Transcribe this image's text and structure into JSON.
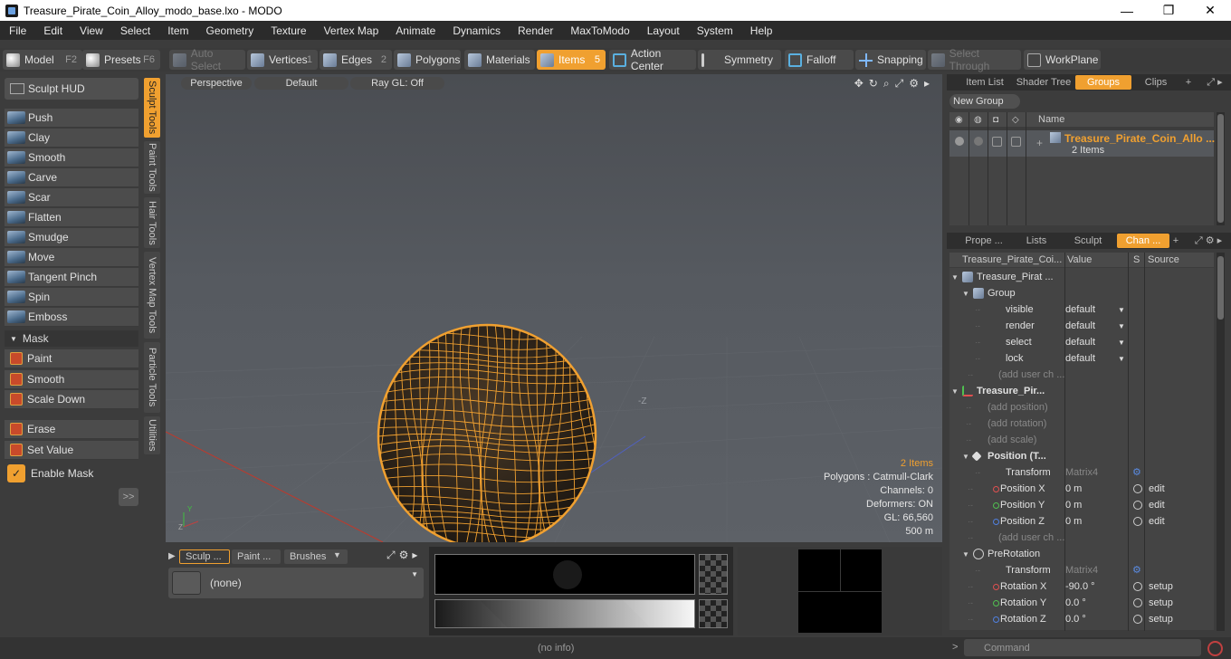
{
  "window": {
    "title": "Treasure_Pirate_Coin_Alloy_modo_base.lxo - MODO",
    "minimize": "—",
    "maximize": "❐",
    "close": "✕"
  },
  "menu": [
    "File",
    "Edit",
    "View",
    "Select",
    "Item",
    "Geometry",
    "Texture",
    "Vertex Map",
    "Animate",
    "Dynamics",
    "Render",
    "MaxToModo",
    "Layout",
    "System",
    "Help"
  ],
  "toolbar": {
    "model": "Model",
    "model_key": "F2",
    "presets": "Presets",
    "presets_key": "F6",
    "auto_select": "Auto Select",
    "vertices": "Vertices",
    "vertices_key": "1",
    "edges": "Edges",
    "edges_key": "2",
    "polygons": "Polygons",
    "materials": "Materials",
    "items": "Items",
    "items_key": "5",
    "action_center": "Action Center",
    "symmetry": "Symmetry",
    "falloff": "Falloff",
    "snapping": "Snapping",
    "select_through": "Select Through",
    "workplane": "WorkPlane",
    "accent": "#f0a030"
  },
  "sculpt": {
    "hud": "Sculpt HUD",
    "tools": [
      "Push",
      "Clay",
      "Smooth",
      "Carve",
      "Scar",
      "Flatten",
      "Smudge",
      "Move",
      "Tangent Pinch",
      "Spin",
      "Emboss"
    ],
    "mask_header": "Mask",
    "mask_tools": [
      "Paint",
      "Smooth",
      "Scale Down"
    ],
    "other_tools": [
      "Erase",
      "Set Value"
    ],
    "enable_mask": "Enable Mask",
    "expand": ">>",
    "side_tabs": [
      "Sculpt Tools",
      "Paint Tools",
      "Hair Tools",
      "Vertex Map Tools",
      "Particle Tools",
      "Utilities"
    ]
  },
  "viewport": {
    "view": "Perspective",
    "shading": "Default",
    "raygl": "Ray GL: Off",
    "axis_label": "-Z",
    "info": {
      "items": "2 Items",
      "polygons": "Polygons : Catmull-Clark",
      "channels": "Channels: 0",
      "deformers": "Deformers: ON",
      "gl": "GL: 66,560",
      "scale": "500 m"
    }
  },
  "brush_panel": {
    "tabs": [
      "Sculp ...",
      "Paint ...",
      "Brushes"
    ],
    "selected": "(none)"
  },
  "status": {
    "info": "(no info)",
    "command_placeholder": "Command"
  },
  "groups_panel": {
    "tabs": [
      "Item List",
      "Shader Tree",
      "Groups",
      "Clips"
    ],
    "new_group": "New Group",
    "col_name": "Name",
    "group_name": "Treasure_Pirate_Coin_Allo ...",
    "group_sub": "2 Items"
  },
  "channels_panel": {
    "tabs": [
      "Prope ...",
      "Lists",
      "Sculpt",
      "Chan ..."
    ],
    "col_item": "Treasure_Pirate_Coi...",
    "col_value": "Value",
    "col_s": "S",
    "col_source": "Source",
    "rows": [
      {
        "name": "Treasure_Pirat ...",
        "value": "",
        "src": ""
      },
      {
        "name": "Group",
        "value": "",
        "src": ""
      },
      {
        "name": "visible",
        "value": "default",
        "src": ""
      },
      {
        "name": "render",
        "value": "default",
        "src": ""
      },
      {
        "name": "select",
        "value": "default",
        "src": ""
      },
      {
        "name": "lock",
        "value": "default",
        "src": ""
      },
      {
        "name": "(add user ch ...",
        "value": "",
        "src": ""
      },
      {
        "name": "Treasure_Pir...",
        "value": "",
        "src": ""
      },
      {
        "name": "(add position)",
        "value": "",
        "src": ""
      },
      {
        "name": "(add rotation)",
        "value": "",
        "src": ""
      },
      {
        "name": "(add scale)",
        "value": "",
        "src": ""
      },
      {
        "name": "Position (T...",
        "value": "",
        "src": ""
      },
      {
        "name": "Transform",
        "value": "Matrix4",
        "src": ""
      },
      {
        "name": "Position X",
        "value": "0 m",
        "src": "edit"
      },
      {
        "name": "Position Y",
        "value": "0 m",
        "src": "edit"
      },
      {
        "name": "Position Z",
        "value": "0 m",
        "src": "edit"
      },
      {
        "name": "(add user ch ...",
        "value": "",
        "src": ""
      },
      {
        "name": "PreRotation",
        "value": "",
        "src": ""
      },
      {
        "name": "Transform",
        "value": "Matrix4",
        "src": ""
      },
      {
        "name": "Rotation X",
        "value": "-90.0 °",
        "src": "setup"
      },
      {
        "name": "Rotation Y",
        "value": "0.0 °",
        "src": "setup"
      },
      {
        "name": "Rotation Z",
        "value": "0.0 °",
        "src": "setup"
      }
    ]
  }
}
